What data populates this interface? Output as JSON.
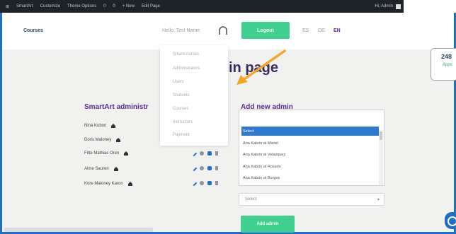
{
  "admin_bar": {
    "items": [
      "SmartArt",
      "Customize",
      "Theme Options",
      "0",
      "0",
      "+ New",
      "Edit Page"
    ],
    "howdy": "Hi, Admin"
  },
  "header": {
    "courses": "Courses",
    "user_name": "Hello, Test Name",
    "cta_label": "Logout",
    "languages": [
      "ES",
      "DE",
      "EN"
    ],
    "active_language": "EN"
  },
  "dropdown_menu": {
    "items": [
      "Smartcourses",
      "Administrators",
      "Users",
      "Students",
      "Courses",
      "Instructors",
      "Payment"
    ]
  },
  "page": {
    "title": "in page"
  },
  "left_section": {
    "title": "SmartArt administr",
    "admins": [
      "Nina Kubon",
      "Doris Maloney",
      "Fitte Mathias Oren",
      "Aime Sauren",
      "Kore Maloney Karon"
    ]
  },
  "right_section": {
    "title": "Add new admin",
    "listbox_items": [
      "Select",
      "Ana Kabon at Mariel",
      "Ana Kabon at Velazquez",
      "Ana Kabon at Rosario",
      "Ana Kabon at Burgos"
    ],
    "selected_index": 0,
    "select_value": "Select",
    "submit_label": "Add admin"
  },
  "widget": {
    "number": "248",
    "sub": "Apps"
  },
  "colors": {
    "accent_green": "#3fcf8e",
    "title_purple": "#5b2d8e",
    "frame_blue": "#1f6fc5",
    "annotation_orange": "#f5a623"
  }
}
